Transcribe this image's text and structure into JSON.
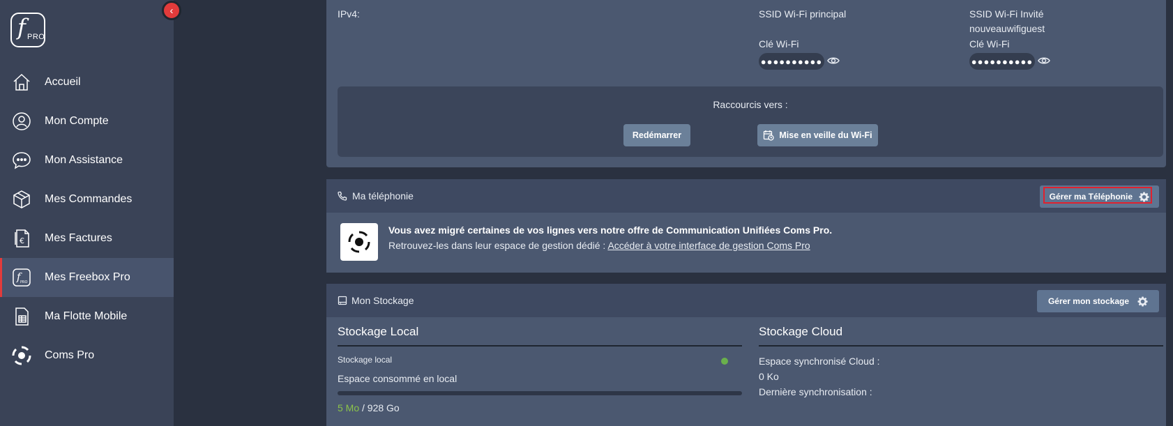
{
  "sidebar": {
    "logo": {
      "letter": "f",
      "sub": "PRO"
    },
    "items": [
      {
        "label": "Accueil",
        "icon": "home-icon"
      },
      {
        "label": "Mon Compte",
        "icon": "user-icon"
      },
      {
        "label": "Mon Assistance",
        "icon": "chat-bubble-icon"
      },
      {
        "label": "Mes Commandes",
        "icon": "package-icon"
      },
      {
        "label": "Mes Factures",
        "icon": "invoice-euro-icon"
      },
      {
        "label": "Mes Freebox Pro",
        "icon": "freebox-pro-icon",
        "active": true
      },
      {
        "label": "Ma Flotte Mobile",
        "icon": "sim-card-icon"
      },
      {
        "label": "Coms Pro",
        "icon": "coms-pro-icon"
      }
    ]
  },
  "network": {
    "ipv4_label": "IPv4:",
    "ssid_main_label": "SSID Wi-Fi principal",
    "ssid_guest_label": "SSID Wi-Fi Invité",
    "ssid_guest_value": "nouveauwifiguest",
    "key_label_main": "Clé Wi-Fi",
    "key_label_guest": "Clé Wi-Fi",
    "key_masked_main": "●●●●●●●●●●",
    "key_masked_guest": "●●●●●●●●●●"
  },
  "shortcuts": {
    "title": "Raccourcis vers :",
    "restart_label": "Redémarrer",
    "wifi_sleep_label": "Mise en veille du Wi-Fi"
  },
  "telephony": {
    "title": "Ma téléphonie",
    "manage_label": "Gérer ma Téléphonie",
    "message_bold": "Vous avez migré certaines de vos lignes vers notre offre de Communication Unifiées Coms Pro.",
    "message_prefix": "Retrouvez-les dans leur espace de gestion dédié :",
    "message_link": "Accéder à votre interface de gestion Coms Pro"
  },
  "storage": {
    "title": "Mon Stockage",
    "manage_label": "Gérer mon stockage",
    "local": {
      "heading": "Stockage Local",
      "device_label": "Stockage local",
      "consumed_label": "Espace consommé en local",
      "used": "5 Mo",
      "separator": " / ",
      "total": "928 Go",
      "used_fraction": 1e-05
    },
    "cloud": {
      "heading": "Stockage Cloud",
      "synced_label": "Espace synchronisé Cloud :",
      "synced_value": "0 Ko",
      "last_sync_label": "Dernière synchronisation :"
    }
  },
  "colors": {
    "accent_red": "#e23b3b",
    "status_green": "#6ab04c"
  }
}
